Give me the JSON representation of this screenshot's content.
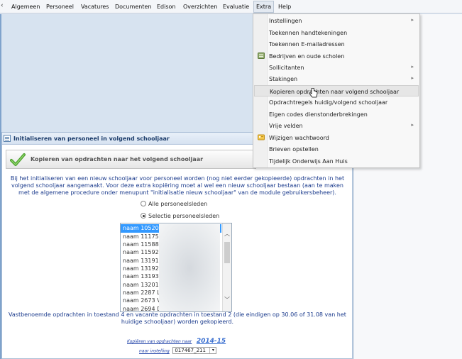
{
  "menubar": {
    "back_glyph": "‹",
    "items": [
      "Algemeen",
      "Personeel",
      "Vacatures",
      "Documenten",
      "Edison",
      "Overzichten",
      "Evaluatie",
      "Extra",
      "Help"
    ]
  },
  "dropdown": {
    "items": [
      {
        "label": "Instellingen",
        "submenu": true
      },
      {
        "label": "Toekennen handtekeningen",
        "submenu": false
      },
      {
        "label": "Toekennen E-mailadressen",
        "submenu": false
      },
      {
        "label": "Bedrijven en oude scholen",
        "submenu": false,
        "icon": "database-icon"
      },
      {
        "label": "Sollicitanten",
        "submenu": true
      },
      {
        "label": "Stakingen",
        "submenu": true
      },
      {
        "label": "Kopieren opdrachten naar volgend schooljaar",
        "submenu": false,
        "hover": true
      },
      {
        "label": "Opdrachtregels huidig/volgend schooljaar",
        "submenu": false
      },
      {
        "label": "Eigen codes dienstonderbrekingen",
        "submenu": false
      },
      {
        "label": "Vrije velden",
        "submenu": true
      },
      {
        "label": "Wijzigen wachtwoord",
        "submenu": false,
        "icon": "password-icon"
      },
      {
        "label": "Brieven opstellen",
        "submenu": false
      },
      {
        "label": "Tijdelijk Onderwijs Aan Huis",
        "submenu": false
      }
    ],
    "submenu_glyph": "▸"
  },
  "panel": {
    "title": "Initialiseren van personeel in volgend schooljaar",
    "action_button": "Kopieren van opdrachten naar het volgend schooljaar",
    "intro": "Bij het initialiseren van een nieuw schooljaar voor personeel worden (nog niet eerder gekopieerde) opdrachten in het volgend schooljaar aangemaakt. Voor deze extra kopiëring moet al wel een nieuw schooljaar bestaan (aan te maken met de algemene procedure onder menupunt \"initialisatie nieuw schooljaar\" van de module gebruikersbeheer).",
    "radio_all": "Alle personeelsleden",
    "radio_selection": "Selectie personeelsleden",
    "list_items": [
      "naam 10520",
      "naam 11175",
      "naam 11588",
      "naam 11592",
      "naam 13191",
      "naam 13192",
      "naam 13193",
      "naam 13201",
      "naam 2287 L",
      "naam 2673 V",
      "naam 2694 D"
    ],
    "scroll_up": "︿",
    "scroll_down": "﹀",
    "note": "Vastbenoemde opdrachten in toestand 4 en vacante opdrachten in toestand 2 (die eindigen op 30.06 of 31.08 van het huidige schooljaar) worden gekopieerd.",
    "copy_label": "Kopiëren van opdrachten naar",
    "year": "2014-15",
    "institution_label": "naar instelling",
    "institution_value": "017467_211",
    "select_glyph": "▾"
  }
}
